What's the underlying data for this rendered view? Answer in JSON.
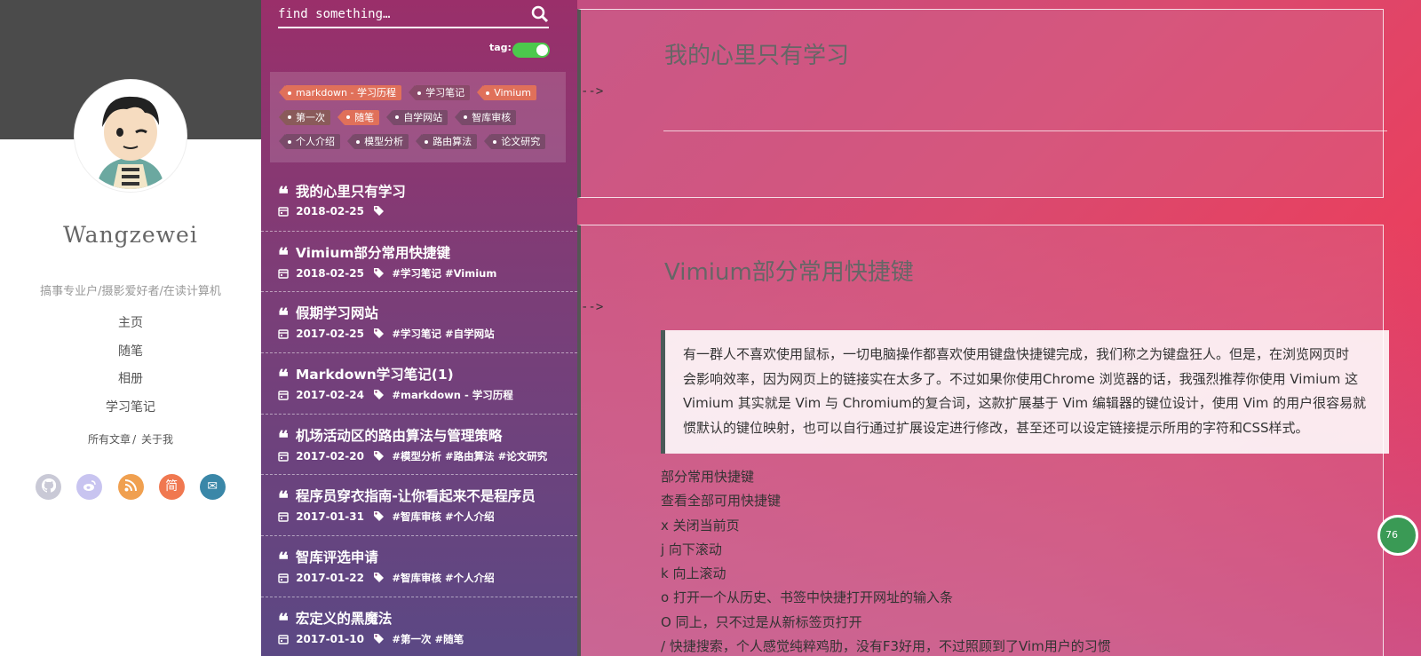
{
  "sidebar": {
    "author": "Wangzewei",
    "tagline": "搞事专业户/摄影爱好者/在读计算机",
    "nav": [
      "主页",
      "随笔",
      "相册",
      "学习笔记"
    ],
    "subnav": {
      "all_posts": "所有文章",
      "separator": "/",
      "about": "关于我"
    },
    "socials": [
      {
        "icon": "github-icon",
        "glyph": "",
        "color": "#c9c9d6"
      },
      {
        "icon": "weibo-icon",
        "glyph": "",
        "color": "#c8c4f0"
      },
      {
        "icon": "rss-icon",
        "glyph": "",
        "color": "#f0a050"
      },
      {
        "icon": "jianshu-icon",
        "glyph": "简",
        "color": "#f07850"
      },
      {
        "icon": "email-icon",
        "glyph": "✉",
        "color": "#3a87a8"
      }
    ]
  },
  "listcol": {
    "search_placeholder": "find something…",
    "tag_label": "tag:",
    "tag_toggle_on": true,
    "tags": [
      [
        {
          "label": "markdown - 学习历程",
          "color": "#e0705a"
        },
        {
          "label": "学习笔记",
          "color": "#8a4a6a"
        },
        {
          "label": "Vimium",
          "color": "#e0705a"
        }
      ],
      [
        {
          "label": "第一次",
          "color": "#8a5a5a"
        },
        {
          "label": "随笔",
          "color": "#e0705a"
        },
        {
          "label": "自学网站",
          "color": "#7a4a6a"
        },
        {
          "label": "智库审核",
          "color": "#7a4a6a"
        }
      ],
      [
        {
          "label": "个人介绍",
          "color": "#7a4a6a"
        },
        {
          "label": "模型分析",
          "color": "#7a4a6a"
        },
        {
          "label": "路由算法",
          "color": "#7a4a6a"
        },
        {
          "label": "论文研究",
          "color": "#7a4a6a"
        }
      ]
    ],
    "posts": [
      {
        "title": "我的心里只有学习",
        "date": "2018-02-25",
        "tags": ""
      },
      {
        "title": "Vimium部分常用快捷键",
        "date": "2018-02-25",
        "tags": "#学习笔记 #Vimium"
      },
      {
        "title": "假期学习网站",
        "date": "2017-02-25",
        "tags": "#学习笔记 #自学网站"
      },
      {
        "title": "Markdown学习笔记(1)",
        "date": "2017-02-24",
        "tags": "#markdown - 学习历程"
      },
      {
        "title": "机场活动区的路由算法与管理策略",
        "date": "2017-02-20",
        "tags": "#模型分析 #路由算法 #论文研究"
      },
      {
        "title": "程序员穿衣指南-让你看起来不是程序员",
        "date": "2017-01-31",
        "tags": "#智库审核 #个人介绍"
      },
      {
        "title": "智库评选申请",
        "date": "2017-01-22",
        "tags": "#智库审核 #个人介绍"
      },
      {
        "title": "宏定义的黑魔法",
        "date": "2017-01-10",
        "tags": "#第一次 #随笔"
      }
    ]
  },
  "main": {
    "post1": {
      "title": "我的心里只有学习",
      "arrow": "-->"
    },
    "post2": {
      "title": "Vimium部分常用快捷键",
      "arrow": "-->",
      "quote": [
        "有一群人不喜欢使用鼠标，一切电脑操作都喜欢使用键盘快捷键完成，我们称之为键盘狂人。但是，在浏览网页时",
        "会影响效率，因为网页上的链接实在太多了。不过如果你使用Chrome 浏览器的话，我强烈推荐你使用 Vimium 这",
        "Vimium 其实就是 Vim 与 Chromium的复合词，这款扩展基于 Vim 编辑器的键位设计，使用 Vim 的用户很容易就",
        "惯默认的键位映射，也可以自行通过扩展设定进行修改，甚至还可以设定链接提示所用的字符和CSS样式。"
      ],
      "lines": [
        "部分常用快捷键",
        "查看全部可用快捷键",
        "x 关闭当前页",
        "j 向下滚动",
        "k 向上滚动",
        "o 打开一个从历史、书签中快捷打开网址的输入条",
        "O 同上，只不过是从新标签页打开",
        "/ 快捷搜索，个人感觉纯粹鸡肋，没有F3好用，不过照顾到了Vim用户的习惯"
      ]
    },
    "badge": "76"
  }
}
